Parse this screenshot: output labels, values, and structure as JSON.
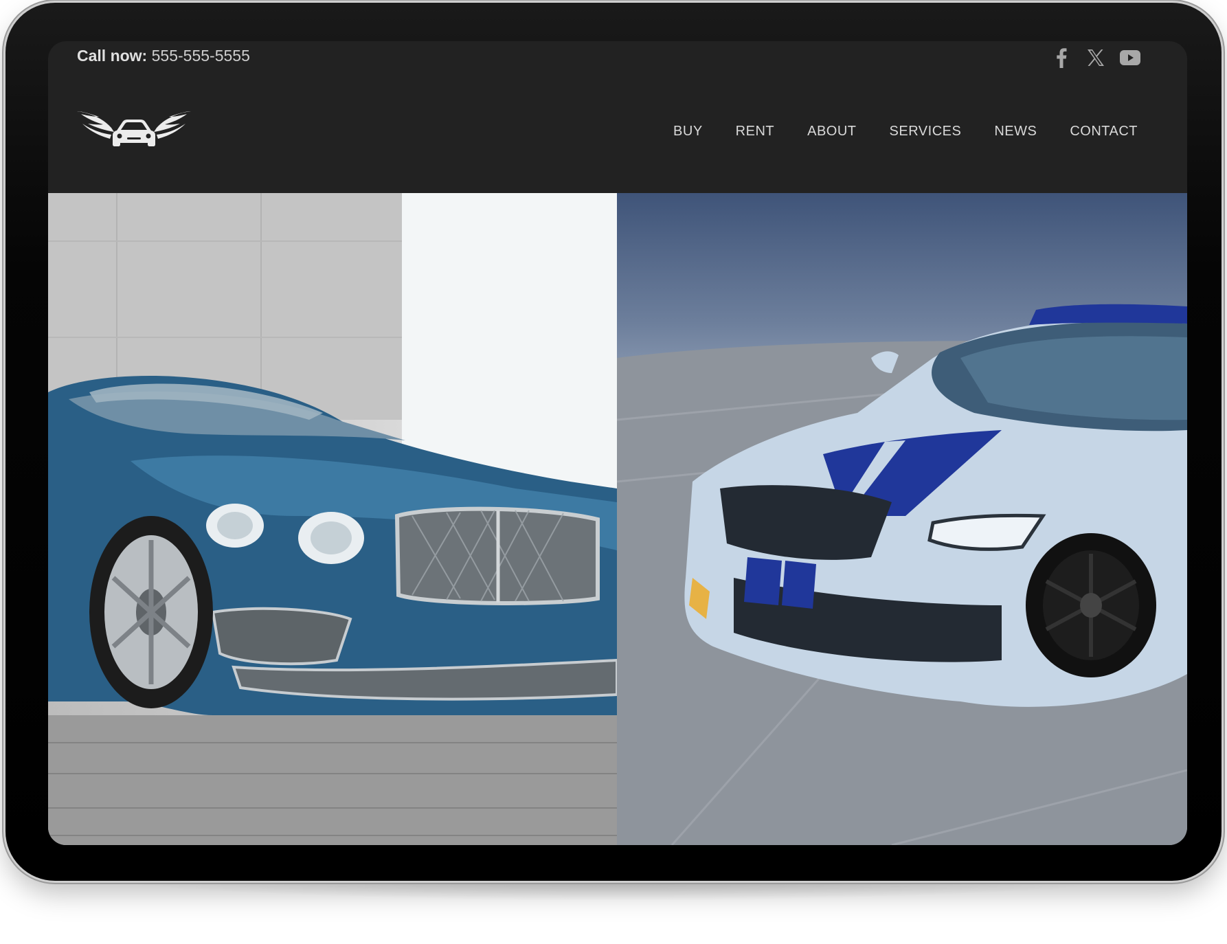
{
  "topbar": {
    "call_label": "Call now:",
    "phone": "555-555-5555"
  },
  "social": [
    {
      "icon": "facebook-icon"
    },
    {
      "icon": "x-icon"
    },
    {
      "icon": "youtube-icon"
    }
  ],
  "logo": {
    "icon": "winged-car-logo"
  },
  "nav": {
    "items": [
      "BUY",
      "RENT",
      "ABOUT",
      "SERVICES",
      "NEWS",
      "CONTACT"
    ]
  },
  "hero": {
    "left_image": "blue-convertible-photo",
    "right_image": "white-striped-sports-car-photo"
  },
  "colors": {
    "header_bg": "#222222",
    "nav_text": "#d9d9d9",
    "device_frame": "#000000"
  }
}
